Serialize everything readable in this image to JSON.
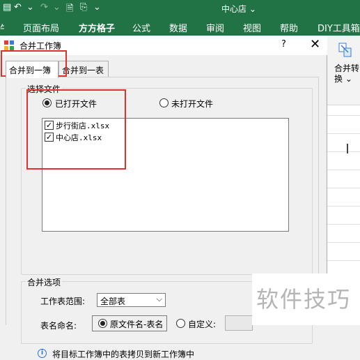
{
  "excel": {
    "doc_title": "中心店 ⌄",
    "qat": {
      "undo": "↶",
      "redo": "↷",
      "sep": "⌄"
    },
    "tabs": [
      "页面布局",
      "方方格子",
      "公式",
      "数据",
      "审阅",
      "视图",
      "帮助",
      "DIY工具箱"
    ],
    "active_tab_bold": "方方格子",
    "ribbon": {
      "merge_label_line1": "合并转",
      "merge_label_line2": "换 ⌄"
    }
  },
  "dialog": {
    "title": "合并工作簿",
    "help": "?",
    "close": "✕",
    "tabs": [
      "合并到一簿",
      "合并到一表"
    ],
    "select_files": {
      "legend": "选择文件",
      "opened_label": "已打开文件",
      "unopened_label": "未打开文件",
      "files": [
        {
          "name": "步行街店.xlsx",
          "checked": true
        },
        {
          "name": "中心店.xlsx",
          "checked": true
        }
      ]
    },
    "merge_options": {
      "legend": "合并选项",
      "sheet_range_label": "工作表范围:",
      "sheet_range_value": "全部表",
      "sheet_name_label": "表名命名:",
      "naming_option1": "原文件名-表名",
      "naming_option2": "自定义:"
    },
    "info_text": "将目标工作簿中的表拷贝到新工作簿中"
  },
  "watermark": "软件技巧",
  "colors": {
    "excel_green": "#217346",
    "highlight_red": "#e0322c"
  }
}
